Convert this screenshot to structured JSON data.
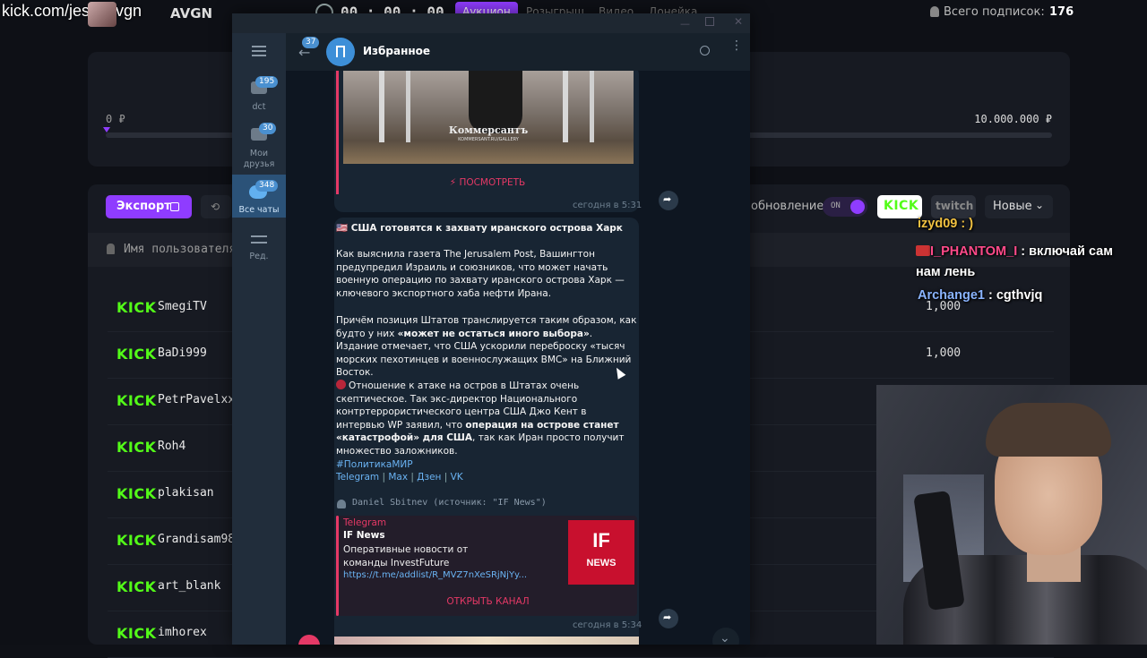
{
  "stream": {
    "url_overlay": "kick.com/jesusavgn",
    "streamer_label": "AVGN",
    "timer": "00 : 00 : 00"
  },
  "dashboard": {
    "tabs": [
      "Аукцион",
      "Розыгрыш",
      "Видео",
      "Донейка"
    ],
    "subscribers_label": "Всего подписок:",
    "subscribers_count": "176",
    "progress": {
      "min_label": "0 ₽",
      "max_label": "10.000.000 ₽",
      "fraction": 0.0
    },
    "export_label": "Экспорт",
    "autoupdate_label": "обновление",
    "toggle_label": "ON",
    "platform_kick": "KICK",
    "platform_twitch": "twitch",
    "sort_label": "Новые",
    "username_header": "Имя пользователя",
    "rows": [
      {
        "platform": "KICK",
        "name": "SmegiTV",
        "amount": "1,000"
      },
      {
        "platform": "KICK",
        "name": "BaDi999",
        "amount": "1,000"
      },
      {
        "platform": "KICK",
        "name": "PetrPavelxx",
        "amount": ""
      },
      {
        "platform": "KICK",
        "name": "Roh4",
        "amount": ""
      },
      {
        "platform": "KICK",
        "name": "plakisan",
        "amount": ""
      },
      {
        "platform": "KICK",
        "name": "Grandisam98",
        "amount": ""
      },
      {
        "platform": "KICK",
        "name": "art_blank",
        "amount": ""
      },
      {
        "platform": "KICK",
        "name": "imhorex",
        "amount": ""
      }
    ]
  },
  "telegram": {
    "sidebar": {
      "folders": [
        {
          "label": "dct",
          "badge": "195"
        },
        {
          "label": "Мои друзья",
          "badge": "30"
        },
        {
          "label": "Все чаты",
          "badge": "348"
        },
        {
          "label": "Ред.",
          "badge": ""
        }
      ]
    },
    "header": {
      "back_badge": "37",
      "title": "Избранное"
    },
    "msg1": {
      "image_caption": "Коммерсантъ",
      "image_subcaption": "KOMMERSANT.RU/GALLERY",
      "button": "⚡ ПОСМОТРЕТЬ",
      "time": "сегодня в 5:31"
    },
    "msg2": {
      "title": "🇺🇸 США готовятся к захвату иранского острова Харк",
      "p1": "Как выяснила газета The Jerusalem Post, Вашингтон предупредил Израиль и союзников, что может начать военную операцию по захвату иранского острова Харк — ключевого экспортного хаба нефти Ирана.",
      "p2_a": "Причём позиция Штатов транслируется таким образом, как будто у них ",
      "p2_b": "«может не остаться иного выбора»",
      "p2_c": ". Издание отмечает, что США ускорили переброску «тысяч морских пехотинцев и военнослужащих ВМС» на Ближний Восток.",
      "p3_a": "Отношение к атаке на остров в Штатах очень скептическое. Так экс-директор Национального контртеррористического центра США Джо Кент в интервью WP заявил, что ",
      "p3_b": "операция на острове станет «катастрофой» для США",
      "p3_c": ", так как Иран просто получит множество заложников.",
      "hashtag": "#ПолитикаМИР",
      "links": [
        "Telegram",
        "Max",
        "Дзен",
        "VK"
      ],
      "forward_from": "Daniel Sbitnev (источник: \"IF News\")",
      "preview": {
        "site": "Telegram",
        "title": "IF News",
        "desc": "Оперативные новости от команды InvestFuture",
        "url": "https://t.me/addlist/R_MVZ7nXeSRjNjYy...",
        "logo_top": "IF",
        "logo_bottom": "NEWS"
      },
      "button": "ОТКРЫТЬ КАНАЛ",
      "time": "сегодня в 5:34"
    }
  },
  "chat_overlay": [
    {
      "user": "",
      "text": "izyd09 : )",
      "color": "#f0c040"
    },
    {
      "user": "I_PHANTOM_I",
      "text": "включай сам нам лень",
      "color": "#ff4a8a"
    },
    {
      "user": "Archange1",
      "text": "cgthvjq",
      "color": "#8ab4ff"
    }
  ],
  "colors": {
    "kick_green": "#53fc18",
    "telegram_accent": "#6ab3f3",
    "auction_purple": "#8f3cff",
    "telegram_button": "#e53966"
  }
}
